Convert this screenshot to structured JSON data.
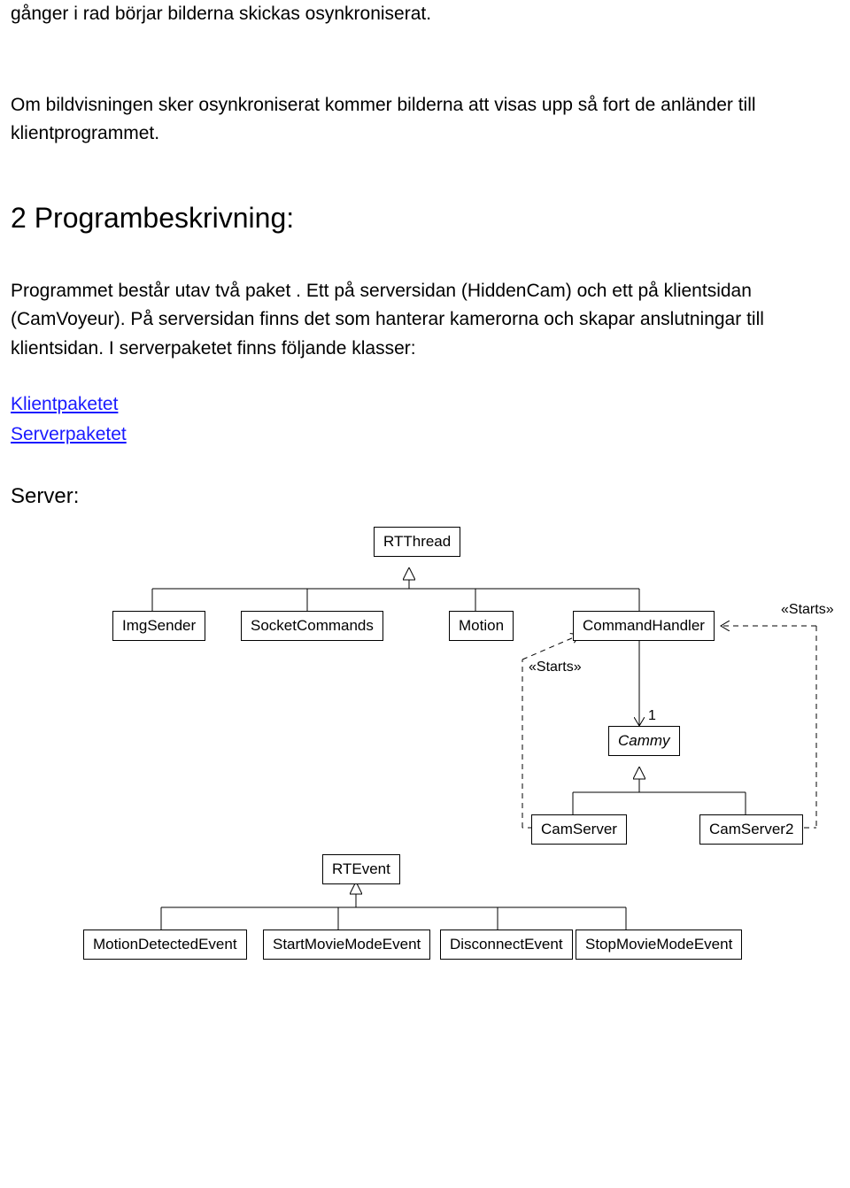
{
  "para1": "gånger i rad börjar bilderna skickas osynkroniserat.",
  "para2": "Om bildvisningen sker osynkroniserat kommer bilderna att visas upp så fort de anländer till klientprogrammet.",
  "heading2": "2 Programbeskrivning:",
  "para3": "Programmet består utav två paket . Ett på serversidan (HiddenCam) och ett på klientsidan (CamVoyeur). På serversidan finns det som hanterar kamerorna och skapar anslutningar till klientsidan. I serverpaketet finns följande klasser:",
  "link1": "Klientpaketet",
  "link2": "Serverpaketet",
  "heading3": "Server:",
  "uml": {
    "rtthread": "RTThread",
    "imgsender": "ImgSender",
    "socketcommands": "SocketCommands",
    "motion": "Motion",
    "commandhandler": "CommandHandler",
    "cammy": "Cammy",
    "camserver": "CamServer",
    "camserver2": "CamServer2",
    "rtevent": "RTEvent",
    "motiondetected": "MotionDetectedEvent",
    "startmovie": "StartMovieModeEvent",
    "disconnect": "DisconnectEvent",
    "stopmovie": "StopMovieModeEvent",
    "starts1": "«Starts»",
    "starts2": "«Starts»",
    "one": "1"
  }
}
